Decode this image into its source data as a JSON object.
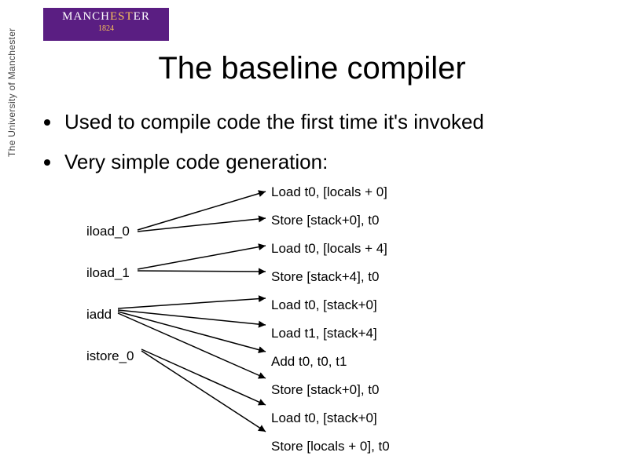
{
  "logo": {
    "name_part1": "MANCH",
    "name_part2": "EST",
    "name_part3": "ER",
    "year": "1824"
  },
  "sidebar": "The University of Manchester",
  "title": "The baseline compiler",
  "bullets": [
    "Used to compile code the first time it's invoked",
    "Very simple code generation:"
  ],
  "bytecodes": [
    "iload_0",
    "iload_1",
    "iadd",
    "istore_0"
  ],
  "outputs": [
    "Load t0, [locals + 0]",
    "Store [stack+0], t0",
    "Load t0, [locals + 4]",
    "Store [stack+4], t0",
    "Load t0, [stack+0]",
    "Load t1, [stack+4]",
    "Add t0, t0, t1",
    "Store [stack+0], t0",
    "Load t0, [stack+0]",
    "Store [locals + 0], t0"
  ]
}
